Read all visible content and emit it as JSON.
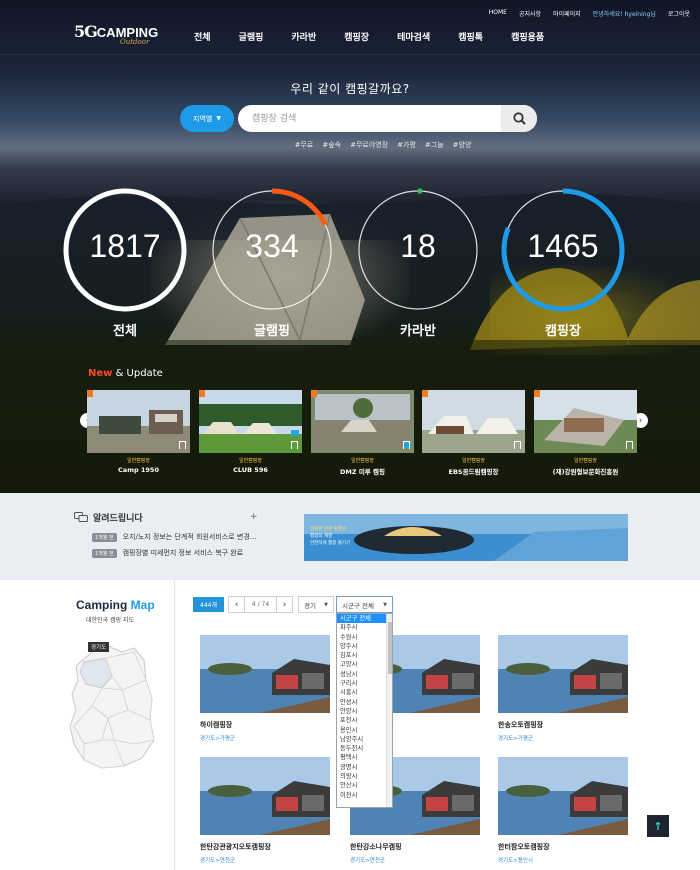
{
  "header": {
    "logo_prefix": "5G",
    "logo_name": "CAMPING",
    "logo_sub": "Outdoor",
    "top_links": [
      "HOME",
      "공지사항",
      "마이페이지"
    ],
    "user_greeting": "안녕하세요! hyeining님",
    "logout": "로그아웃",
    "nav": [
      "전체",
      "글램핑",
      "카라반",
      "캠핑장",
      "테마검색",
      "캠핑톡",
      "캠핑용품"
    ]
  },
  "search": {
    "tagline": "우리 같이 캠핑갈까요?",
    "region_label": "지역별",
    "placeholder": "캠핑장 검색",
    "hashtags": [
      "#무료",
      "#숲속",
      "#무료야영장",
      "#가평",
      "#그늘",
      "#양양"
    ]
  },
  "stats": [
    {
      "value": "1817",
      "label": "전체",
      "progress": 1.0,
      "color": "#ffffff"
    },
    {
      "value": "334",
      "label": "글램핑",
      "progress": 0.18,
      "color": "#ff5a14"
    },
    {
      "value": "18",
      "label": "카라반",
      "progress": 0.01,
      "color": "#26d04a"
    },
    {
      "value": "1465",
      "label": "캠핑장",
      "progress": 0.81,
      "color": "#1e9be8"
    }
  ],
  "new_update": {
    "title_new": "New",
    "title_rest": " & Update",
    "cards": [
      {
        "category": "일반캠핑장",
        "name": "Camp 1950"
      },
      {
        "category": "일반캠핑장",
        "name": "CLUB 596"
      },
      {
        "category": "일반캠핑장",
        "name": "DMZ 미루 캠핑"
      },
      {
        "category": "일반캠핑장",
        "name": "EBS꿈드림캠핑장"
      },
      {
        "category": "일반캠핑장",
        "name": "(재)강원형보문화진흥원"
      }
    ]
  },
  "notice": {
    "title": "알려드립니다",
    "plus": "+",
    "items": [
      {
        "date": "1개월 전",
        "text": "오지/노지 정보는 단계적 회원서비스로 변경..."
      },
      {
        "date": "1개월 전",
        "text": "캠핑장별 미세먼지 정보 서비스 복구 완료"
      }
    ],
    "banner_lines": [
      "행복한 건강 여행의",
      "캠핑의 계절",
      "안전하게 캠핑 즐기기"
    ]
  },
  "camping_map": {
    "title_a": "Camping",
    "title_b": " Map",
    "subtitle": "대한민국 캠핑 지도",
    "region_tag": "경기도"
  },
  "list": {
    "count": "444개",
    "page": "4 / 74",
    "province": "경기",
    "district": "시군구 전체",
    "dropdown_options": [
      "시군구 전체",
      "파주시",
      "수원시",
      "양주시",
      "김포시",
      "고양시",
      "성남시",
      "구리시",
      "시흥시",
      "안성시",
      "안양시",
      "포천시",
      "용인시",
      "남양주시",
      "동두천시",
      "평택시",
      "광명시",
      "의왕시",
      "안산시",
      "이천시"
    ],
    "results": [
      {
        "name": "하이캠핑장",
        "addr": "경기도>가평군"
      },
      {
        "name": "캠핑장",
        "addr": ""
      },
      {
        "name": "한송오토캠핑장",
        "addr": "경기도>가평군"
      },
      {
        "name": "한탄강관광지오토캠핑장",
        "addr": "경기도>연천군"
      },
      {
        "name": "한탄강소나무캠핑",
        "addr": "경기도>연천군"
      },
      {
        "name": "한터팜오토캠핑장",
        "addr": "경기도>용인시"
      }
    ]
  },
  "top_button": "↑"
}
